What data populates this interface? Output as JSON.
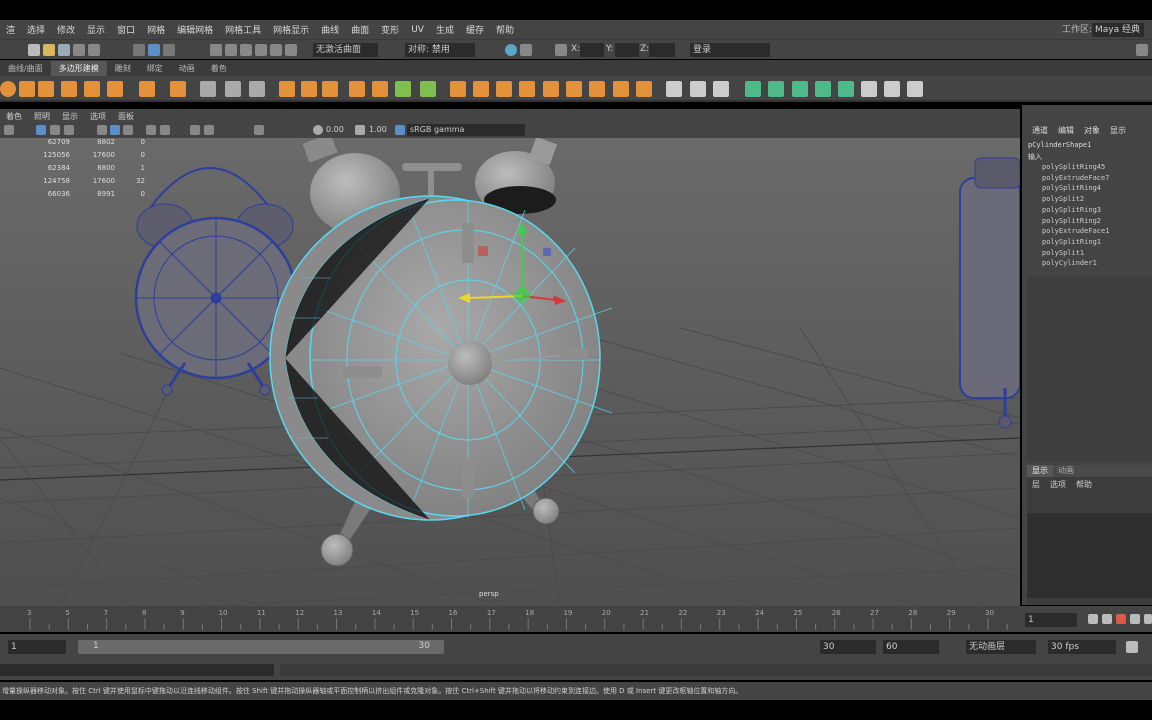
{
  "menubar": {
    "items": [
      "渲",
      "选择",
      "修改",
      "显示",
      "窗口",
      "网格",
      "编辑网格",
      "网格工具",
      "网格显示",
      "曲线",
      "曲面",
      "变形",
      "UV",
      "生成",
      "缓存",
      "帮助"
    ],
    "workspace_label": "工作区:",
    "workspace_value": "Maya 经典*"
  },
  "statusline": {
    "live_surface": "无激活曲面",
    "symmetry": "对称: 禁用",
    "x_label": "X:",
    "y_label": "Y:",
    "z_label": "Z:",
    "login": "登录"
  },
  "shelf": {
    "tabs": [
      "曲线/曲面",
      "多边形建模",
      "雕刻",
      "绑定",
      "动画",
      "着色"
    ],
    "active_tab": "多边形建模"
  },
  "panel": {
    "menus": [
      "着色",
      "照明",
      "显示",
      "选项",
      "面板"
    ],
    "value1": "0.00",
    "value2": "1.00",
    "colorspace": "sRGB gamma"
  },
  "hud": {
    "rows": [
      [
        "62709",
        "8802",
        "0"
      ],
      [
        "125056",
        "17600",
        "0"
      ],
      [
        "62384",
        "8800",
        "1"
      ],
      [
        "124758",
        "17600",
        "32"
      ],
      [
        "66036",
        "8991",
        "0"
      ]
    ],
    "camera": "persp"
  },
  "channelbox": {
    "tabs": [
      "通道",
      "编辑",
      "对象",
      "显示"
    ],
    "node": "pCylinderShape1",
    "inputs_label": "输入",
    "history": [
      "polySplitRing45",
      "polyExtrudeFace7",
      "polySplitRing4",
      "polySplit2",
      "polySplitRing3",
      "polySplitRing2",
      "polyExtrudeFace1",
      "polySplitRing1",
      "polySplit1",
      "polyCylinder1"
    ]
  },
  "layers": {
    "tabs": [
      "显示",
      "动画"
    ],
    "menus": [
      "层",
      "选项",
      "帮助"
    ]
  },
  "timeline": {
    "ticks": [
      "3",
      "5",
      "7",
      "8",
      "9",
      "10",
      "11",
      "12",
      "13",
      "14",
      "15",
      "16",
      "17",
      "18",
      "19",
      "20",
      "21",
      "22",
      "23",
      "24",
      "25",
      "26",
      "27",
      "28",
      "29",
      "30"
    ],
    "current_frame": "1"
  },
  "range": {
    "start": "1",
    "inner_start": "1",
    "inner_end": "30",
    "end": "30",
    "anim_end": "60",
    "char_set": "无动画层",
    "fps": "30 fps"
  },
  "help_text": "增量操纵器移动对象。按住 Ctrl 键并使用鼠标中键拖动以沿连线移动组件。按住 Shift 键并拖动操纵器轴或平面控制柄以挤出组件或克隆对象。按住 Ctrl+Shift 键并拖动以将移动约束到连接边。使用 D 或 Insert 键更改枢轴位置和轴方向。"
}
